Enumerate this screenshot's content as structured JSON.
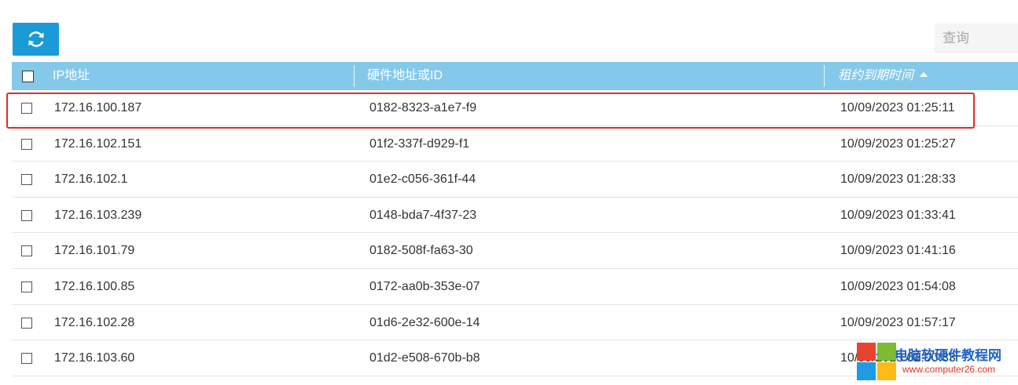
{
  "toolbar": {
    "refresh_icon": "refresh-icon"
  },
  "search": {
    "placeholder": "查询"
  },
  "table": {
    "headers": {
      "ip": "IP地址",
      "hw": "硬件地址或ID",
      "lease": "租约到期时间"
    },
    "sort": {
      "column": "lease",
      "direction": "ascending"
    },
    "rows": [
      {
        "ip": "172.16.100.187",
        "hw": "0182-8323-a1e7-f9",
        "lease": "10/09/2023 01:25:11"
      },
      {
        "ip": "172.16.102.151",
        "hw": "01f2-337f-d929-f1",
        "lease": "10/09/2023 01:25:27"
      },
      {
        "ip": "172.16.102.1",
        "hw": "01e2-c056-361f-44",
        "lease": "10/09/2023 01:28:33"
      },
      {
        "ip": "172.16.103.239",
        "hw": "0148-bda7-4f37-23",
        "lease": "10/09/2023 01:33:41"
      },
      {
        "ip": "172.16.101.79",
        "hw": "0182-508f-fa63-30",
        "lease": "10/09/2023 01:41:16"
      },
      {
        "ip": "172.16.100.85",
        "hw": "0172-aa0b-353e-07",
        "lease": "10/09/2023 01:54:08"
      },
      {
        "ip": "172.16.102.28",
        "hw": "01d6-2e32-600e-14",
        "lease": "10/09/2023 01:57:17"
      },
      {
        "ip": "172.16.103.60",
        "hw": "01d2-e508-670b-b8",
        "lease": "10/09/2023 02:00:33"
      }
    ]
  },
  "watermark": {
    "title": "电脑软硬件教程网",
    "url": "www.computer26.com"
  },
  "colors": {
    "accent": "#1a9ad6",
    "header_bg": "#85c9ea",
    "highlight": "#e02a2a"
  }
}
